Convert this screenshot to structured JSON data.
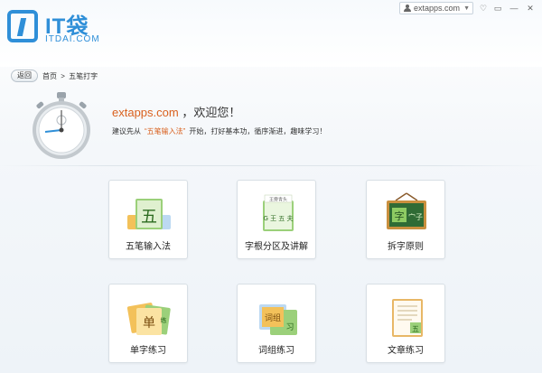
{
  "logo": {
    "name": "IT袋",
    "sub": "ITDAI.COM"
  },
  "account": {
    "name": "extapps.com"
  },
  "window_controls": [
    "♡",
    "▭",
    "—",
    "✕"
  ],
  "breadcrumb": {
    "back": "返回",
    "home": "首页",
    "sep": ">",
    "current": "五笔打字"
  },
  "banner": {
    "site": "extapps.com",
    "welcome": "，欢迎您！",
    "tip_prefix": "建议先从",
    "tip_highlight": "“五笔输入法”",
    "tip_suffix": "开始，打好基本功，循序渐进，趣味学习！"
  },
  "cards": [
    {
      "label": "五笔输入法",
      "art_char": "五"
    },
    {
      "label": "字根分区及讲解",
      "art_char": "G 王 五 夫",
      "art_top": "王旁青头"
    },
    {
      "label": "拆字原则",
      "art_char": "字",
      "art_char2": "宀子"
    },
    {
      "label": "单字练习",
      "art_char": "单",
      "art_char2": "练"
    },
    {
      "label": "词组练习",
      "art_char": "词组",
      "art_char2": "习"
    },
    {
      "label": "文章练习",
      "art_char": "五"
    }
  ],
  "colors": {
    "brand": "#2f8fd8",
    "highlight": "#d9601d"
  }
}
